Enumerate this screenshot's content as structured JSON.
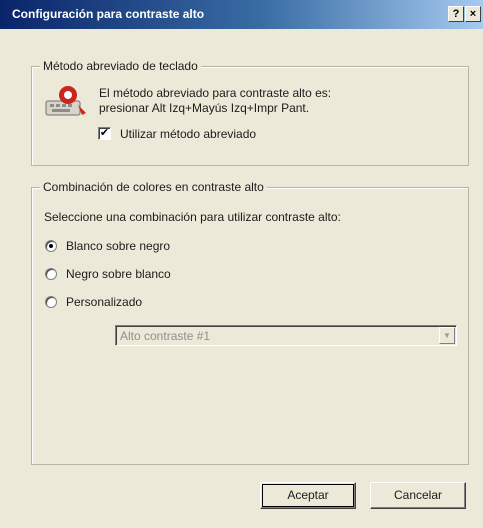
{
  "window": {
    "title": "Configuración para contraste alto",
    "help_label": "?",
    "close_label": "×"
  },
  "shortcut_group": {
    "legend": "Método abreviado de teclado",
    "description_line1": "El método abreviado para contraste alto es:",
    "description_line2": "presionar Alt Izq+Mayús Izq+Impr Pant.",
    "checkbox_label": "Utilizar método abreviado",
    "checkbox_checked": true,
    "icon": "accessibility-keyboard-icon"
  },
  "color_group": {
    "legend": "Combinación de colores en contraste alto",
    "prompt": "Seleccione una combinación para utilizar contraste alto:",
    "options": [
      {
        "label": "Blanco sobre negro",
        "checked": true
      },
      {
        "label": "Negro sobre blanco",
        "checked": false
      },
      {
        "label": "Personalizado",
        "checked": false
      }
    ],
    "custom_select_value": "Alto contraste #1"
  },
  "buttons": {
    "ok_label": "Aceptar",
    "cancel_label": "Cancelar"
  },
  "colors": {
    "dialog_face": "#ece9d8",
    "title_start": "#0a246a",
    "title_end": "#a6caf0",
    "icon_red": "#c8261e"
  }
}
